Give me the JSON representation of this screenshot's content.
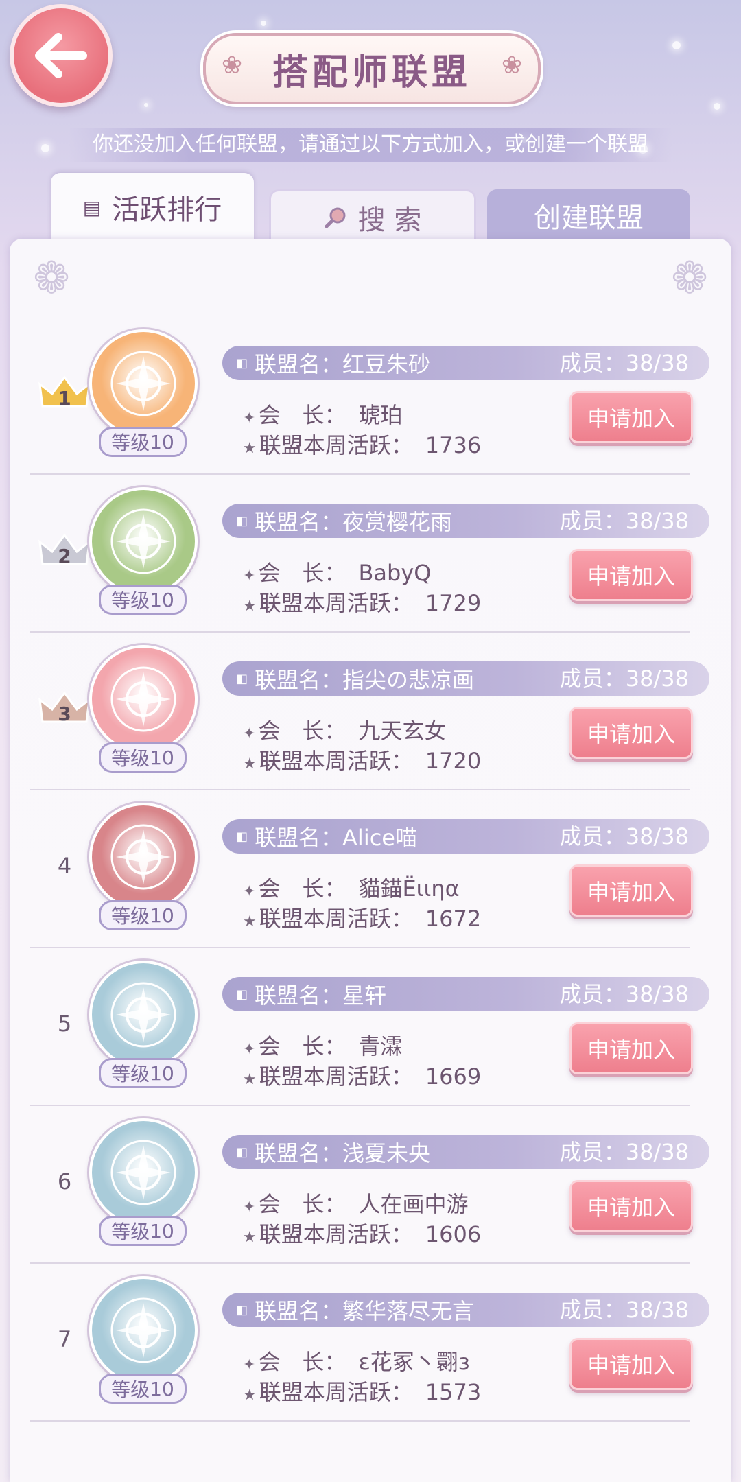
{
  "header": {
    "title": "搭配师联盟",
    "subtitle": "你还没加入任何联盟，请通过以下方式加入，或创建一个联盟"
  },
  "tabs": [
    {
      "label": "活跃排行",
      "icon": "list-icon"
    },
    {
      "label": "搜 索",
      "icon": "search-icon"
    },
    {
      "label": "创建联盟",
      "icon": ""
    }
  ],
  "row_labels": {
    "name_prefix": "联盟名：",
    "members_prefix": "成员：",
    "leader_label": "会　长：",
    "activity_label": "联盟本周活跃：",
    "level_prefix": "等级",
    "join_label": "申请加入"
  },
  "alliances": [
    {
      "rank": "1",
      "name": "红豆朱砂",
      "members": "38/38",
      "leader": "琥珀",
      "activity": "1736",
      "level": "10",
      "emblem": "sun-emblem-icon",
      "color": "#f7b477",
      "crown": "#f1c14d"
    },
    {
      "rank": "2",
      "name": "夜赏樱花雨",
      "members": "38/38",
      "leader": "BabyQ",
      "activity": "1729",
      "level": "10",
      "emblem": "ornament-emblem-icon",
      "color": "#a9c987",
      "crown": "#c9c9d4"
    },
    {
      "rank": "3",
      "name": "指尖の悲凉画",
      "members": "38/38",
      "leader": "九天玄女",
      "activity": "1720",
      "level": "10",
      "emblem": "crown-emblem-icon",
      "color": "#f3a6ad",
      "crown": "#d7b3a6"
    },
    {
      "rank": "4",
      "name": "Alice喵",
      "members": "38/38",
      "leader": "貓錨Ëιιηα",
      "activity": "1672",
      "level": "10",
      "emblem": "winged-emblem-icon",
      "color": "#d8858a",
      "crown": ""
    },
    {
      "rank": "5",
      "name": "星轩",
      "members": "38/38",
      "leader": "青瀮",
      "activity": "1669",
      "level": "10",
      "emblem": "swan-emblem-icon",
      "color": "#a9cbd9",
      "crown": ""
    },
    {
      "rank": "6",
      "name": "浅夏未央",
      "members": "38/38",
      "leader": "人在画中游",
      "activity": "1606",
      "level": "10",
      "emblem": "swan-emblem-icon",
      "color": "#a9cbd9",
      "crown": ""
    },
    {
      "rank": "7",
      "name": "繁华落尽无言",
      "members": "38/38",
      "leader": "ε花冢丶翾з",
      "activity": "1573",
      "level": "10",
      "emblem": "swan-emblem-icon",
      "color": "#a9cbd9",
      "crown": ""
    }
  ]
}
